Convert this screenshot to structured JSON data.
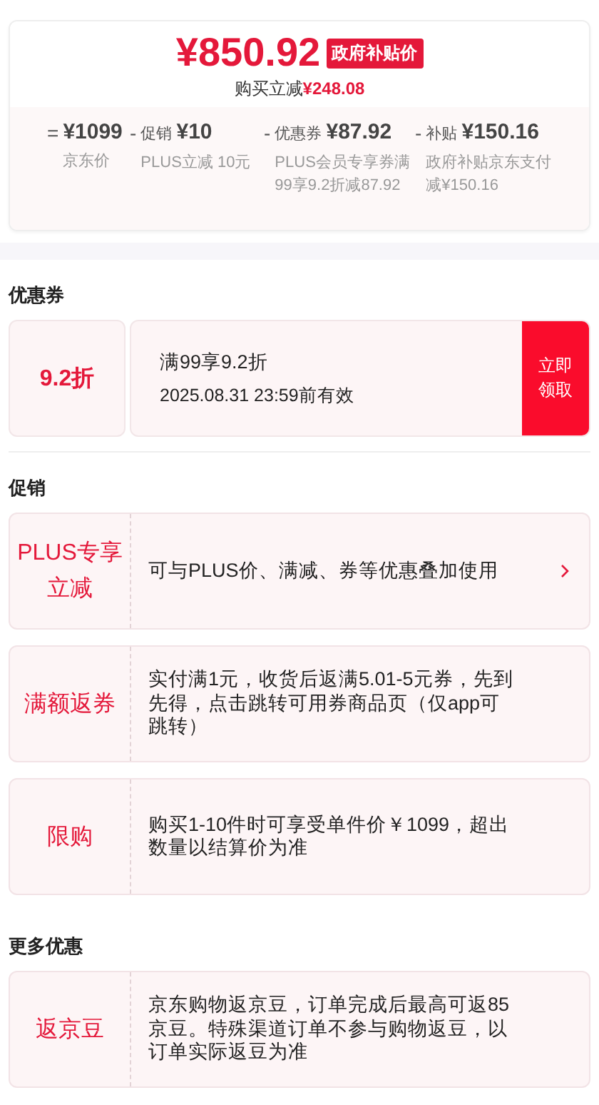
{
  "price": {
    "amount": "¥850.92",
    "badge": "政府补贴价",
    "saving_label": "购买立减",
    "saving_amount": "¥248.08"
  },
  "breakdown": [
    {
      "operator": "=",
      "amount": "¥1099",
      "note": "京东价"
    },
    {
      "operator": "-",
      "label": "促销",
      "amount": "¥10",
      "note": "PLUS立减 10元"
    },
    {
      "operator": "-",
      "label": "优惠券",
      "amount": "¥87.92",
      "note": "PLUS会员专享券满99享9.2折减87.92"
    },
    {
      "operator": "-",
      "label": "补贴",
      "amount": "¥150.16",
      "note": "政府补贴京东支付减¥150.16"
    }
  ],
  "coupon_section": {
    "title": "优惠券",
    "coupon": {
      "discount": "9.2折",
      "condition": "满99享9.2折",
      "validity": "2025.08.31 23:59前有效",
      "button": "立即领取"
    }
  },
  "promotion_section": {
    "title": "促销",
    "items": [
      {
        "tag": "PLUS专享立减",
        "text": "可与PLUS价、满减、券等优惠叠加使用",
        "kind": "link"
      },
      {
        "tag": "满额返券",
        "text": "实付满1元，收货后返满5.01-5元券，先到先得，点击跳转可用券商品页（仅app可跳转）",
        "kind": "plain"
      },
      {
        "tag": "限购",
        "text": "购买1-10件时可享受单件价￥1099，超出数量以结算价为准",
        "kind": "plain"
      }
    ]
  },
  "more_section": {
    "title": "更多优惠",
    "items": [
      {
        "tag": "返京豆",
        "text": "京东购物返京豆，订单完成后最高可返85京豆。特殊渠道订单不参与购物返豆，以订单实际返豆为准"
      }
    ]
  }
}
